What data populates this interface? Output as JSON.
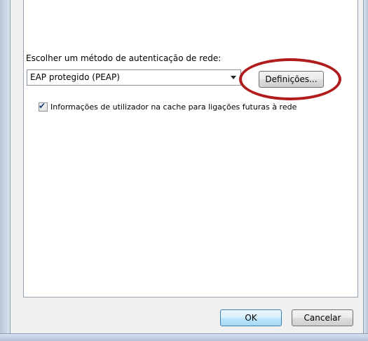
{
  "authentication": {
    "label": "Escolher um método de autenticação de rede:",
    "method_selected": "EAP protegido (PEAP)",
    "settings_button": "Definições..."
  },
  "cache_option": {
    "checked": true,
    "label": "Informações de utilizador na cache para ligações futuras à rede",
    "check_glyph": "✔"
  },
  "footer": {
    "ok_label": "OK",
    "cancel_label": "Cancelar"
  },
  "annotation": {
    "highlight_color": "#b01c1c"
  },
  "icons": {
    "dropdown": "chevron-down-icon",
    "checkbox": "checkmark-icon"
  }
}
